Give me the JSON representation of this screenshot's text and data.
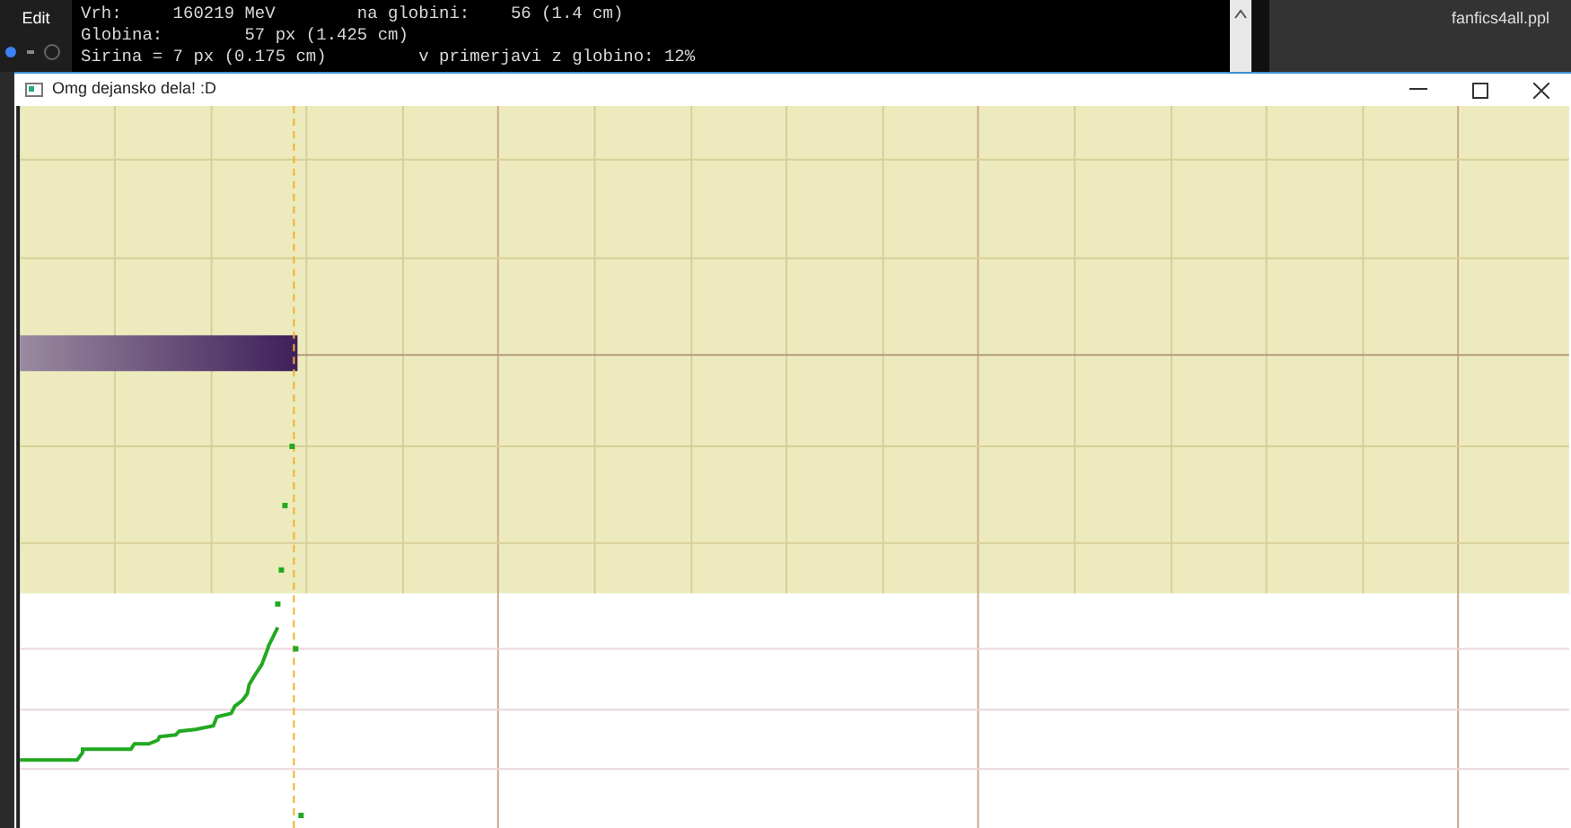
{
  "background_app": {
    "menu": "Edit",
    "console_lines": [
      "Vrh:     160219 MeV        na globini:    56 (1.4 cm)",
      "Globina:        57 px (1.425 cm)",
      "Sirina = 7 px (0.175 cm)         v primerjavi z globino: 12%"
    ],
    "file_tab": "fanfics4all.ppl"
  },
  "window": {
    "title": "Omg dejansko dela! :D"
  }
}
